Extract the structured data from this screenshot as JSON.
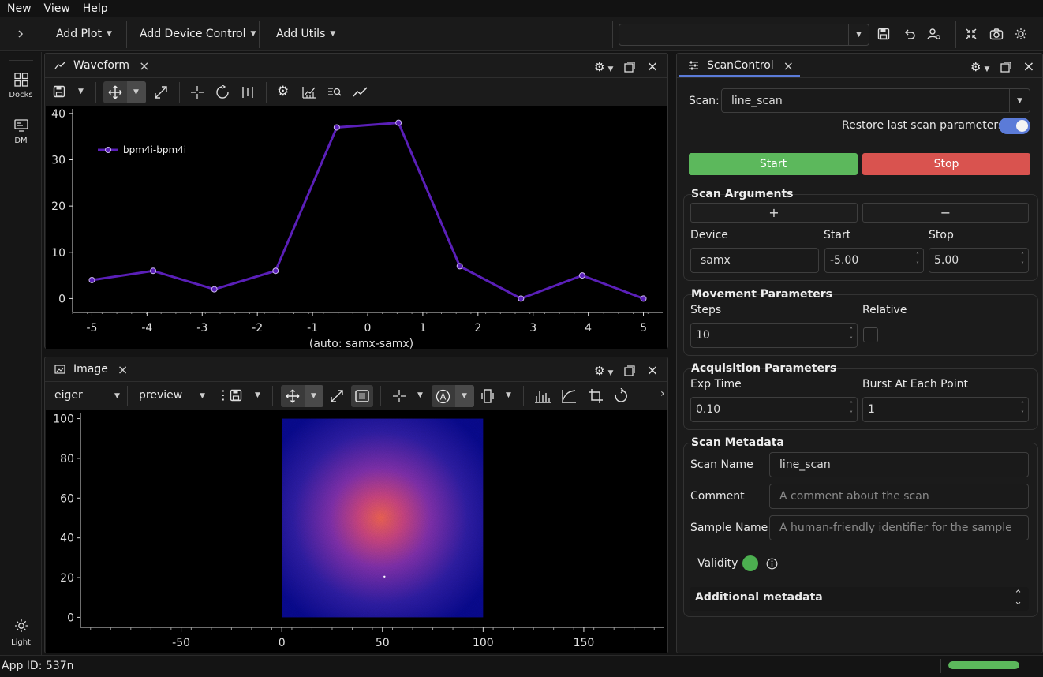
{
  "menu": [
    "New",
    "View",
    "Help"
  ],
  "toolbar": {
    "add_plot": "Add Plot",
    "add_device_control": "Add Device Control",
    "add_utils": "Add Utils",
    "profile_value": ""
  },
  "sidebar": {
    "docks_label": "Docks",
    "dm_label": "DM",
    "theme_label": "Light"
  },
  "waveform": {
    "tab_title": "Waveform",
    "legend": "bpm4i-bpm4i",
    "xlabel": "(auto: samx-samx)"
  },
  "image": {
    "tab_title": "Image",
    "monitor": "eiger",
    "mode": "preview"
  },
  "chart_data": [
    {
      "type": "line",
      "series": [
        {
          "name": "bpm4i-bpm4i",
          "x": [
            -5,
            -3.89,
            -2.78,
            -1.67,
            -0.56,
            0.56,
            1.67,
            2.78,
            3.89,
            5
          ],
          "y": [
            4,
            6,
            2,
            6,
            37,
            38,
            7,
            0,
            5,
            0
          ]
        }
      ],
      "xlabel": "(auto: samx-samx)",
      "ylabel": "",
      "xlim": [
        -5.35,
        5.35
      ],
      "ylim": [
        -3,
        41
      ],
      "xticks": [
        -5,
        -4,
        -3,
        -2,
        -1,
        0,
        1,
        2,
        3,
        4,
        5
      ],
      "yticks": [
        0,
        10,
        20,
        30,
        40
      ],
      "color": "#5a1fb8",
      "grid": false,
      "legend": "top-left"
    },
    {
      "type": "heatmap",
      "xlim": [
        -100,
        190
      ],
      "ylim": [
        -5,
        103
      ],
      "xticks": [
        -50,
        0,
        50,
        100,
        150
      ],
      "yticks": [
        0,
        20,
        40,
        60,
        80,
        100
      ],
      "image_extent": [
        0,
        100,
        0,
        100
      ],
      "peak_center": [
        50,
        50
      ],
      "colormap": [
        "#0a0b9a",
        "#5a2ab8",
        "#c23a9a",
        "#ff6a5a"
      ]
    }
  ],
  "scan": {
    "tab_title": "ScanControl",
    "scan_label": "Scan:",
    "scan_value": "line_scan",
    "restore_label": "Restore last scan parameters",
    "restore_on": true,
    "start_label": "Start",
    "stop_label": "Stop",
    "args_title": "Scan Arguments",
    "plus": "+",
    "minus": "−",
    "col_device": "Device",
    "col_start": "Start",
    "col_stop": "Stop",
    "device_value": "samx",
    "start_value": "-5.00",
    "stop_value": "5.00",
    "movement_title": "Movement Parameters",
    "steps_label": "Steps",
    "relative_label": "Relative",
    "steps_value": "10",
    "acq_title": "Acquisition Parameters",
    "exp_label": "Exp Time",
    "burst_label": "Burst At Each Point",
    "exp_value": "0.10",
    "burst_value": "1",
    "meta_title": "Scan Metadata",
    "scan_name_label": "Scan Name",
    "scan_name_value": "line_scan",
    "comment_label": "Comment",
    "comment_placeholder": "A comment about the scan",
    "sample_label": "Sample Name",
    "sample_placeholder": "A human-friendly identifier for the sample",
    "validity_label": "Validity",
    "additional_label": "Additional metadata"
  },
  "status": {
    "app_id": "App ID: 537n",
    "progress": 1.0
  },
  "colors": {
    "start": "#5cb85c",
    "stop": "#d9534f",
    "accent": "#5b7bd8",
    "valid": "#4caf50"
  }
}
